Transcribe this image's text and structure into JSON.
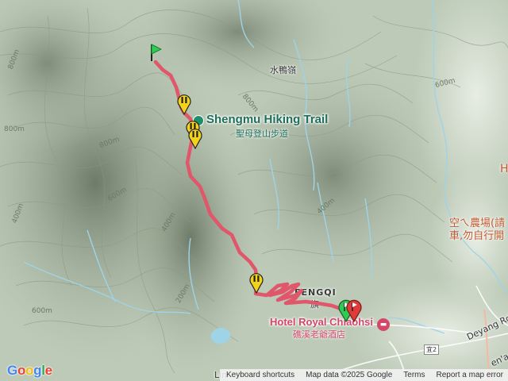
{
  "map": {
    "poi_title": "Shengmu Hiking Trail",
    "poi_subtitle": "聖母登山步道",
    "peak_label": "水鴨嶺",
    "village_label": "FENGQI",
    "village_label_zh": "旗",
    "hotel_label": "Hotel Royal Chiaohsi",
    "hotel_label_zh": "礁溪老爺酒店",
    "farm_label_line1": "空ㄟ農場(請",
    "farm_label_line2": "車,勿自行開",
    "road_label": "Deyang Rd",
    "road_label_2": "en'a",
    "highway_shield": "宜2",
    "edge_letter": "H",
    "bottom_partial": "Lin",
    "contour_labels": [
      "800m",
      "800m",
      "800m",
      "600m",
      "800m",
      "400m",
      "400m",
      "600m",
      "200m",
      "600m",
      "400m"
    ]
  },
  "attribution": {
    "logo": "Google",
    "shortcuts": "Keyboard shortcuts",
    "map_data": "Map data ©2025 Google",
    "terms": "Terms",
    "report": "Report a map error"
  },
  "colors": {
    "route": "#e8505b",
    "start_marker": "#2ecc52",
    "end_marker": "#e03a3a",
    "waypoint_marker": "#f2d21b",
    "water": "#9fd3e6",
    "poi": "#1f6f5c"
  },
  "markers": [
    {
      "type": "start",
      "icon": "flag-icon"
    },
    {
      "type": "waypoint",
      "icon": "pause-icon"
    },
    {
      "type": "waypoint",
      "icon": "pause-icon"
    },
    {
      "type": "waypoint",
      "icon": "pause-icon"
    },
    {
      "type": "waypoint",
      "icon": "pause-icon"
    },
    {
      "type": "start",
      "icon": "flag-icon"
    },
    {
      "type": "end",
      "icon": "flag-icon"
    }
  ]
}
